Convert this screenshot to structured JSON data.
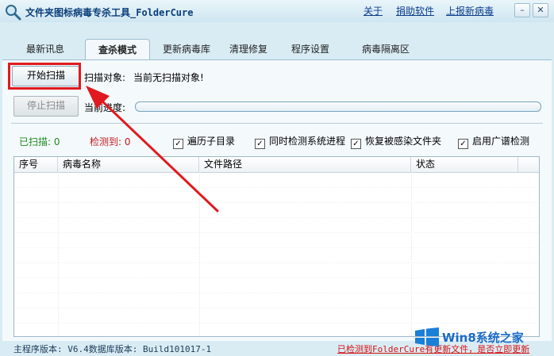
{
  "window": {
    "title": "文件夹图标病毒专杀工具_FolderCure",
    "links": [
      "关于",
      "捐助软件",
      "上报新病毒"
    ]
  },
  "tabs": [
    {
      "label": "最新讯息",
      "active": false
    },
    {
      "label": "查杀模式",
      "active": true
    },
    {
      "label": "更新病毒库",
      "active": false
    },
    {
      "label": "清理修复",
      "active": false
    },
    {
      "label": "程序设置",
      "active": false
    },
    {
      "label": "病毒隔离区",
      "active": false
    }
  ],
  "scan": {
    "start_button": "开始扫描",
    "target_label": "扫描对象:",
    "target_value": "当前无扫描对象!",
    "stop_button": "停止扫描",
    "progress_label": "当前进度:",
    "progress_value": 0
  },
  "counts": {
    "scanned_label": "已扫描: 0",
    "detected_label": "检测到: 0"
  },
  "options": [
    {
      "label": "遍历子目录",
      "checked": true
    },
    {
      "label": "同时检测系统进程",
      "checked": true
    },
    {
      "label": "恢复被感染文件夹",
      "checked": true
    },
    {
      "label": "启用广谱检测",
      "checked": true
    }
  ],
  "table": {
    "columns": [
      "序号",
      "病毒名称",
      "文件路径",
      "状态"
    ],
    "rows": []
  },
  "status": {
    "version": "主程序版本: V6.4数据库版本: Build101017-1",
    "update_notice": "已检测到FolderCure有更新文件，是否立即更新"
  },
  "watermark": {
    "text": "Win8系统之家"
  },
  "colors": {
    "highlight": "#e0191e",
    "arrow": "#e0191e",
    "scanned": "#1f8a1f",
    "detected": "#c61a1a"
  }
}
